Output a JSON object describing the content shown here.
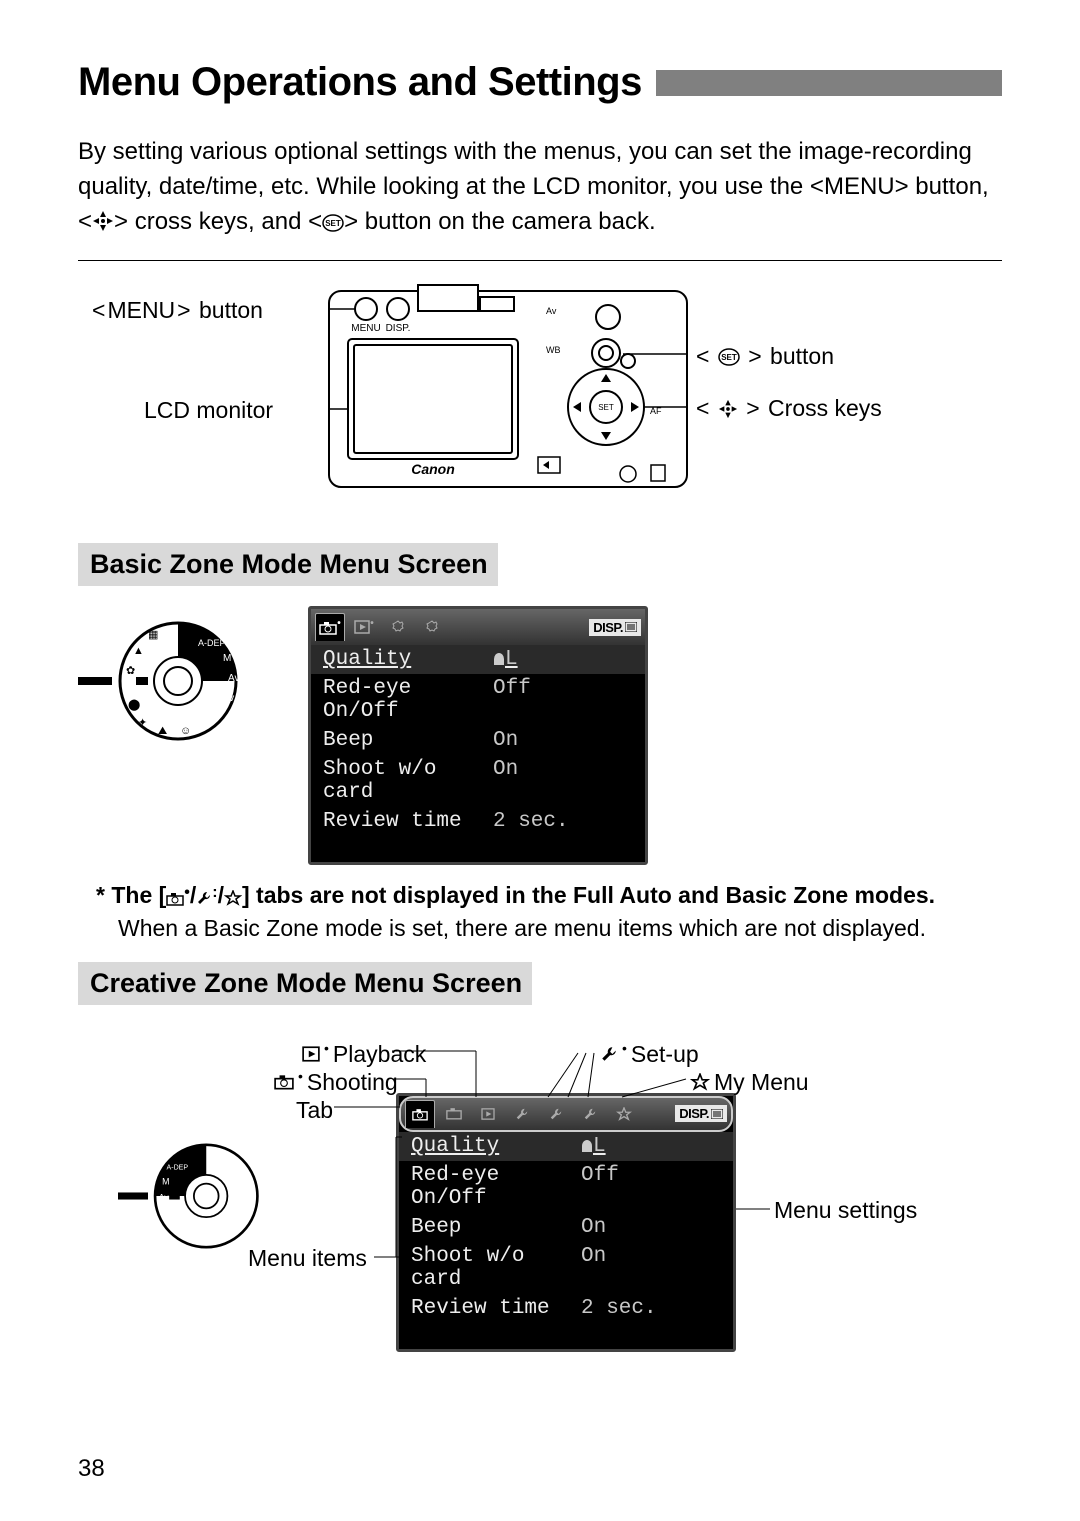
{
  "page_number": "38",
  "title": "Menu Operations and Settings",
  "intro_parts": {
    "a": "By setting various optional settings with the menus, you can set the image-recording quality, date/time, etc. While looking at the LCD monitor, you use the <",
    "b": "MENU",
    "c": "> button, <",
    "d": "> cross keys, and <",
    "e": "> button on the camera back."
  },
  "diagram": {
    "menu_button": "button",
    "menu_button_pre": "MENU",
    "lcd": "LCD monitor",
    "set_button": "button",
    "cross_keys": "Cross keys"
  },
  "section1": "Basic Zone Mode Menu Screen",
  "menu1": {
    "disp": "DISP.",
    "rows": [
      {
        "label": "Quality",
        "value": "L"
      },
      {
        "label": "Red-eye On/Off",
        "value": "Off"
      },
      {
        "label": "Beep",
        "value": "On"
      },
      {
        "label": "Shoot w/o card",
        "value": "On"
      },
      {
        "label": "Review time",
        "value": "2 sec."
      }
    ]
  },
  "footnote": {
    "line1_a": "* The [",
    "line1_b": "] tabs are not displayed in the Full Auto and Basic Zone modes.",
    "line2": "When a Basic Zone mode is set, there are menu items which are not displayed."
  },
  "section2": "Creative Zone Mode Menu Screen",
  "cz_labels": {
    "playback": "Playback",
    "shooting": "Shooting",
    "tab": "Tab",
    "setup": "Set-up",
    "mymenu": "My Menu",
    "menu_items": "Menu items",
    "menu_settings": "Menu settings"
  },
  "menu2": {
    "disp": "DISP.",
    "rows": [
      {
        "label": "Quality",
        "value": "L"
      },
      {
        "label": "Red-eye On/Off",
        "value": "Off"
      },
      {
        "label": "Beep",
        "value": "On"
      },
      {
        "label": "Shoot w/o card",
        "value": "On"
      },
      {
        "label": "Review time",
        "value": "2 sec."
      }
    ]
  }
}
